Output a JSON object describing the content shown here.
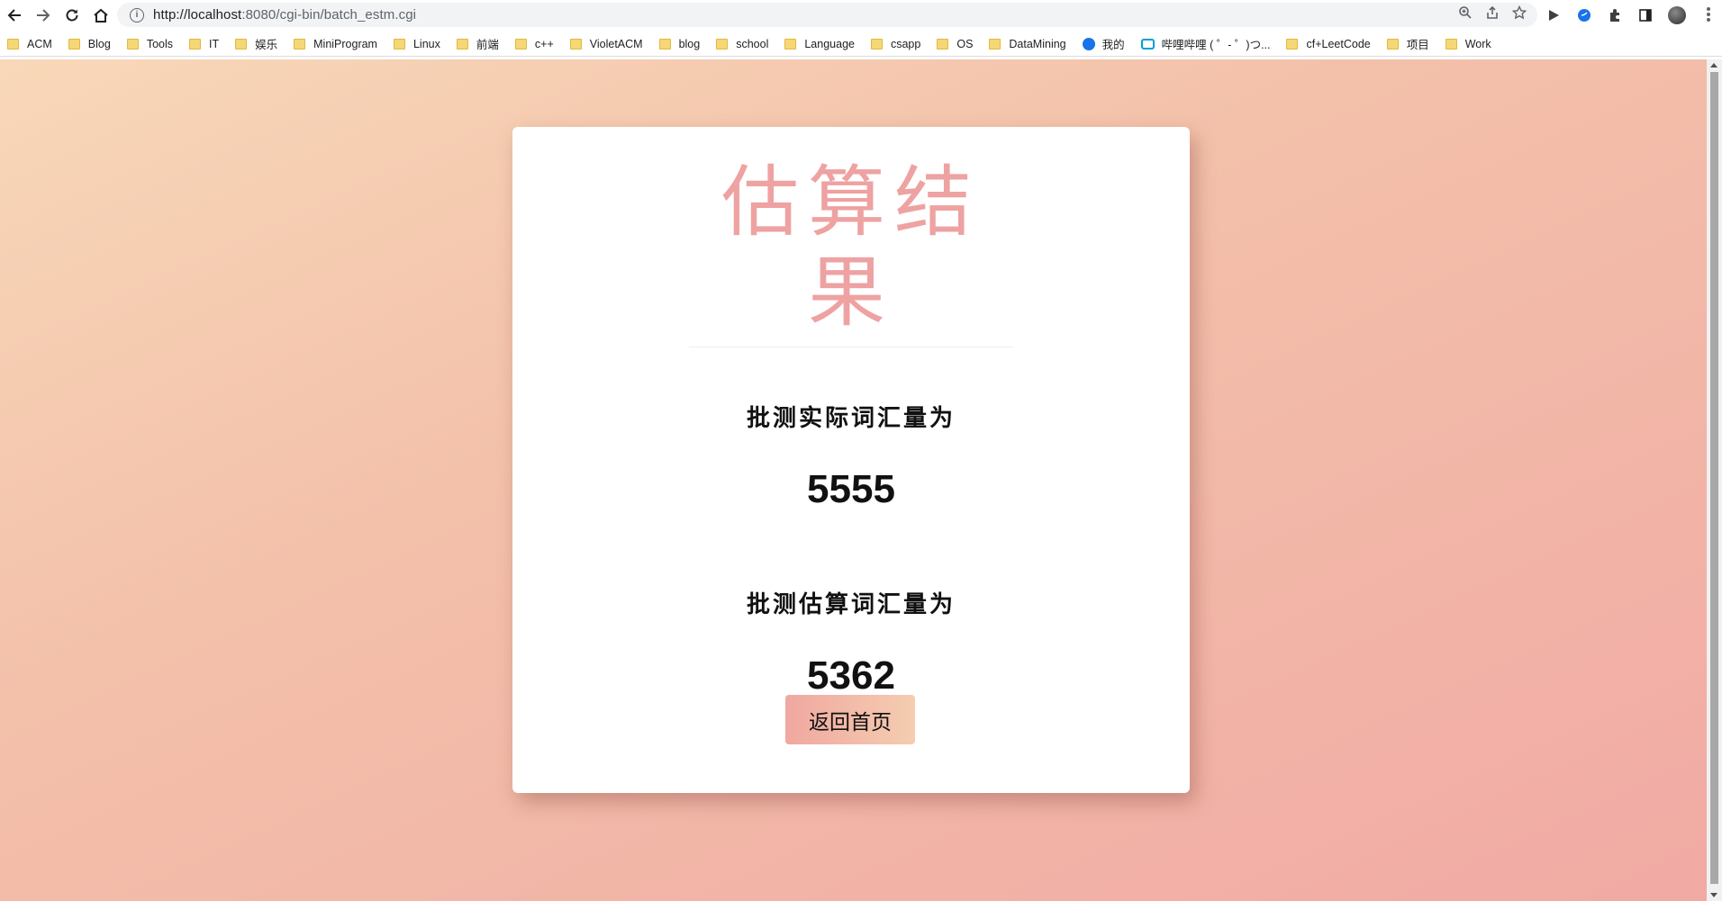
{
  "browser": {
    "url_host": "http://localhost",
    "url_rest": ":8080/cgi-bin/batch_estm.cgi",
    "bookmarks": [
      {
        "label": "ACM",
        "icon": "folder-icon"
      },
      {
        "label": "Blog",
        "icon": "folder-icon"
      },
      {
        "label": "Tools",
        "icon": "folder-icon"
      },
      {
        "label": "IT",
        "icon": "folder-icon"
      },
      {
        "label": "娱乐",
        "icon": "folder-icon"
      },
      {
        "label": "MiniProgram",
        "icon": "folder-icon"
      },
      {
        "label": "Linux",
        "icon": "folder-icon"
      },
      {
        "label": "前端",
        "icon": "folder-icon"
      },
      {
        "label": "c++",
        "icon": "folder-icon"
      },
      {
        "label": "VioletACM",
        "icon": "folder-icon"
      },
      {
        "label": "blog",
        "icon": "folder-icon"
      },
      {
        "label": "school",
        "icon": "folder-icon"
      },
      {
        "label": "Language",
        "icon": "folder-icon"
      },
      {
        "label": "csapp",
        "icon": "folder-icon"
      },
      {
        "label": "OS",
        "icon": "folder-icon"
      },
      {
        "label": "DataMining",
        "icon": "folder-icon"
      },
      {
        "label": "我的",
        "icon": "globe-icon"
      },
      {
        "label": "哔哩哔哩 ( ゜- ゜)つ...",
        "icon": "bilibili-icon"
      },
      {
        "label": "cf+LeetCode",
        "icon": "folder-icon"
      },
      {
        "label": "项目",
        "icon": "folder-icon"
      },
      {
        "label": "Work",
        "icon": "folder-icon"
      }
    ]
  },
  "page": {
    "title": "估算结果",
    "actual_label": "批测实际词汇量为",
    "actual_value": "5555",
    "estimate_label": "批测估算词汇量为",
    "estimate_value": "5362",
    "back_button": "返回首页"
  },
  "colors": {
    "title": "#eea2a2",
    "bg_start": "#f8d8b8",
    "bg_end": "#f1aaa4"
  }
}
